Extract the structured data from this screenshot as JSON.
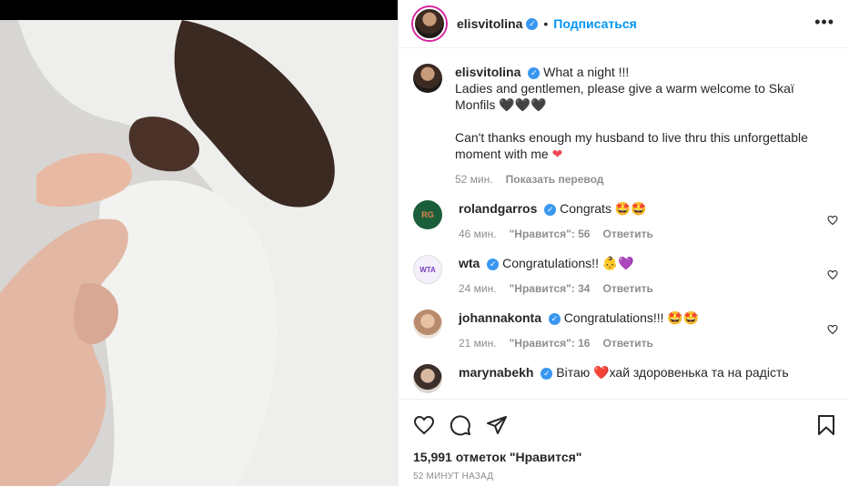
{
  "post": {
    "username": "elisvitolina",
    "follow_label": "Подписаться",
    "more_label": "•••"
  },
  "caption": {
    "username": "elisvitolina",
    "line1": "What a night !!!",
    "line2": "Ladies and gentlemen, please give a warm welcome to Skaï Monfils 🖤🖤🖤",
    "line3": "Can't thanks enough my husband to live thru this unforgettable moment with me",
    "time": "52 мин.",
    "translate_label": "Показать перевод"
  },
  "comments": [
    {
      "username": "rolandgarros",
      "text": "Congrats 🤩🤩",
      "time": "46 мин.",
      "likes": "\"Нравится\": 56",
      "reply": "Ответить",
      "avatar_text": "RG"
    },
    {
      "username": "wta",
      "text": "Congratulations!! 👶💜",
      "time": "24 мин.",
      "likes": "\"Нравится\": 34",
      "reply": "Ответить",
      "avatar_text": "WTA"
    },
    {
      "username": "johannakonta",
      "text": "Congratulations!!! 🤩🤩",
      "time": "21 мин.",
      "likes": "\"Нравится\": 16",
      "reply": "Ответить"
    },
    {
      "username": "marynabekh",
      "text": "Вітаю ❤️хай здоровенька та на радість"
    }
  ],
  "footer": {
    "likes": "15,991 отметок \"Нравится\"",
    "time_ago": "52 МИНУТ НАЗАД"
  },
  "icons": {
    "like": "heart-icon",
    "comment": "comment-icon",
    "share": "share-icon",
    "save": "bookmark-icon"
  },
  "colors": {
    "accent": "#0095f6",
    "verified": "#3897f0",
    "heart": "#ed4956"
  }
}
